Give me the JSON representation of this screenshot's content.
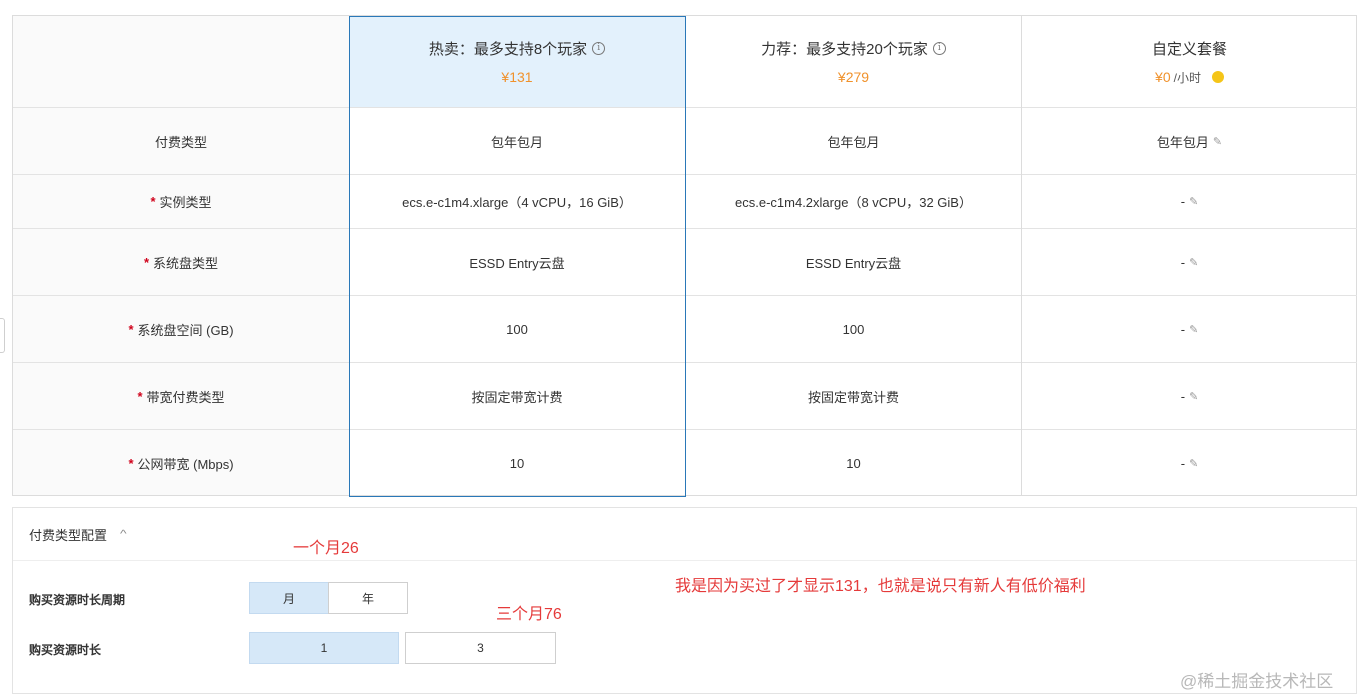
{
  "table": {
    "row_labels": [
      "付费类型",
      "实例类型",
      "系统盘类型",
      "系统盘空间 (GB)",
      "带宽付费类型",
      "公网带宽 (Mbps)"
    ],
    "required_mark": "*",
    "plans": [
      {
        "title": "热卖：最多支持8个玩家",
        "price": "¥131",
        "cells": [
          "包年包月",
          "ecs.e-c1m4.xlarge（4 vCPU，16 GiB）",
          "ESSD Entry云盘",
          "100",
          "按固定带宽计费",
          "10"
        ]
      },
      {
        "title": "力荐：最多支持20个玩家",
        "price": "¥279",
        "cells": [
          "包年包月",
          "ecs.e-c1m4.2xlarge（8 vCPU，32 GiB）",
          "ESSD Entry云盘",
          "100",
          "按固定带宽计费",
          "10"
        ]
      },
      {
        "title": "自定义套餐",
        "price": "¥0",
        "price_unit": "/小时",
        "cells": [
          "包年包月",
          "-",
          "-",
          "-",
          "-",
          "-"
        ]
      }
    ],
    "info_icon": "i",
    "edit_icon": "✎",
    "colors": {
      "accent_border": "#2a78b8",
      "selected_bg": "#e3f1fc",
      "price": "#f0922c",
      "required": "#d0021b",
      "warning_dot": "#f5c518"
    }
  },
  "config": {
    "header": "付费类型配置",
    "chevron": "^",
    "period_label": "购买资源时长周期",
    "period_options": [
      "月",
      "年"
    ],
    "period_selected": "月",
    "duration_label": "购买资源时长",
    "duration_options": [
      "1",
      "3"
    ],
    "duration_selected": "1"
  },
  "annotations": {
    "one_month": "一个月26",
    "three_months": "三个月76",
    "note": "我是因为买过了才显示131，也就是说只有新人有低价福利",
    "color": "#e53a3a"
  },
  "watermark": "@稀土掘金技术社区"
}
